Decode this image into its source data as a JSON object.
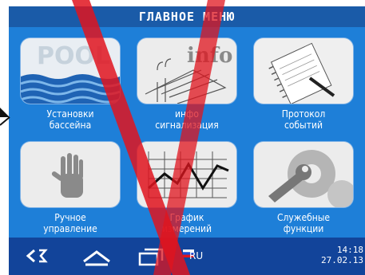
{
  "header": {
    "title": "ГЛАВНОЕ МЕНЮ"
  },
  "tiles": [
    {
      "icon": "pool-icon",
      "label_line1": "Установки",
      "label_line2": "бассейна",
      "image_text": "POOL"
    },
    {
      "icon": "info-icon",
      "label_line1": "инфо",
      "label_line2": "сигнализация",
      "image_text": "info"
    },
    {
      "icon": "notebook-icon",
      "label_line1": "Протокол",
      "label_line2": "событий"
    },
    {
      "icon": "hand-icon",
      "label_line1": "Ручное",
      "label_line2": "управление"
    },
    {
      "icon": "chart-icon",
      "label_line1": "График",
      "label_line2": "измерений"
    },
    {
      "icon": "gear-wrench-icon",
      "label_line1": "Служебные",
      "label_line2": "функции"
    }
  ],
  "bottom_bar": {
    "back_icon": "back-icon",
    "home_icon": "home-icon",
    "windows_icon": "windows-icon",
    "language": "RU",
    "time": "14:18",
    "date": "27.02.13"
  },
  "colors": {
    "screen": "#1e7fd8",
    "title": "#1a5ba8",
    "bottom": "#12449a",
    "accent_red": "#e0141e"
  }
}
